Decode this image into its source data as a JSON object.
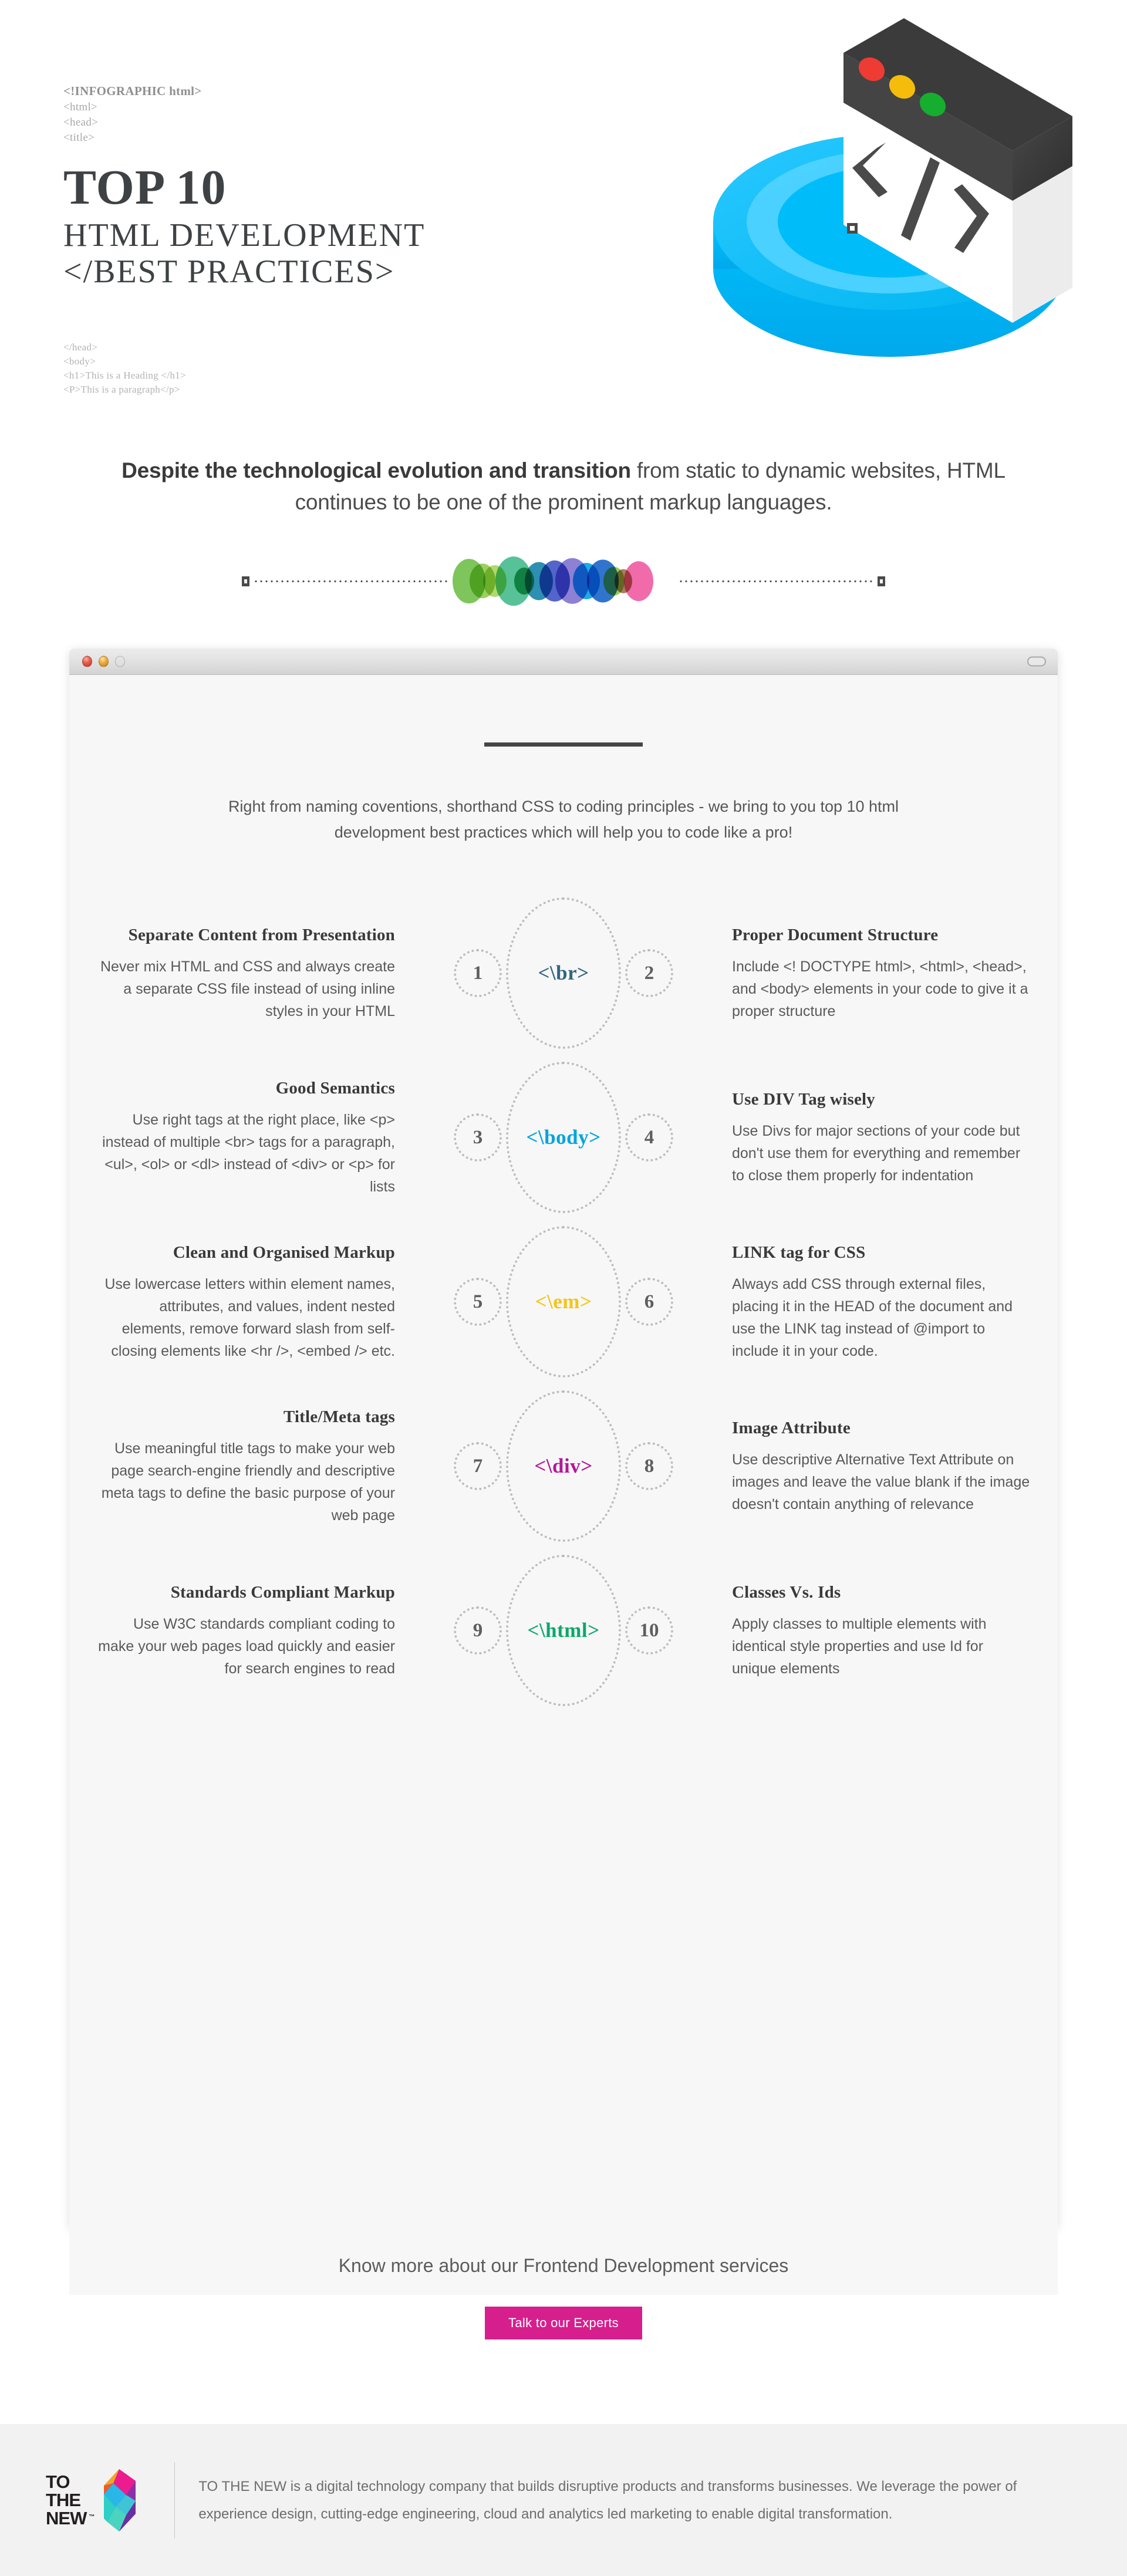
{
  "hero": {
    "code_top_lines": [
      "<!INFOGRAPHIC html>",
      "<html>",
      "<head>",
      "<title>"
    ],
    "title_main": "TOP 10",
    "title_line2": "HTML DEVELOPMENT",
    "title_line3": "</BEST PRACTICES>",
    "code_bottom_lines": [
      "</head>",
      "<body>",
      "<h1>This is a Heading </h1>",
      "<P>This is a paragraph</p>"
    ],
    "illustration": "isometric-code-window-icon"
  },
  "subtitle": {
    "bold_part": "Despite the technological evolution and transition",
    "rest_part": " from static to dynamic websites, HTML continues to be one of the prominent markup languages."
  },
  "divider": {
    "circle_colors": [
      "#6cbe45",
      "#8fc94a",
      "#a6d25a",
      "#3fb98a",
      "#12a05a",
      "#0f7fa8",
      "#3b4fc4",
      "#7c6fd0",
      "#00a0e3",
      "#1461c8",
      "#8cc63f",
      "#9c6b4a",
      "#f0569e"
    ]
  },
  "browser": {
    "traffic_lights": [
      "close-red",
      "minimize-yellow",
      "maximize-green"
    ],
    "resize_control": "window-resize-grip",
    "intro": "Right from naming coventions, shorthand CSS to coding principles - we bring to you top 10 html development best practices which will help you to code like a pro!"
  },
  "rows": [
    {
      "tag": "<\\br>",
      "tag_color": "#31667f",
      "left_number": "1",
      "right_number": "2",
      "left": {
        "heading": "Separate Content from Presentation",
        "body": "Never mix HTML and CSS and always create a separate CSS file instead of using inline styles in your HTML"
      },
      "right": {
        "heading": "Proper Document Structure",
        "body": "Include <! DOCTYPE html>, <html>, <head>, and <body> elements in your code to give it a proper structure"
      }
    },
    {
      "tag": "<\\body>",
      "tag_color": "#00a3e0",
      "left_number": "3",
      "right_number": "4",
      "left": {
        "heading": "Good Semantics",
        "body": "Use right tags at the right place, like <p> instead of multiple <br> tags for a paragraph, <ul>, <ol> or <dl> instead of <div> or <p> for lists"
      },
      "right": {
        "heading": "Use DIV Tag wisely",
        "body": "Use Divs for major sections of your code but don't use them for everything and remember to close them properly for indentation"
      }
    },
    {
      "tag": "<\\em>",
      "tag_color": "#f5c518",
      "left_number": "5",
      "right_number": "6",
      "left": {
        "heading": "Clean and Organised Markup",
        "body": "Use lowercase letters within element names, attributes, and values, indent nested elements, remove forward slash from self-closing elements like <hr />, <embed /> etc."
      },
      "right": {
        "heading": "LINK tag for CSS",
        "body": "Always add CSS through external files, placing it in the HEAD of the document and use the LINK tag instead of @import to include it in your code."
      }
    },
    {
      "tag": "<\\div>",
      "tag_color": "#b4179b",
      "left_number": "7",
      "right_number": "8",
      "left": {
        "heading": "Title/Meta tags",
        "body": "Use meaningful title tags to make your web page search-engine friendly and descriptive meta tags to define the basic purpose of your web page"
      },
      "right": {
        "heading": "Image Attribute",
        "body": "Use descriptive Alternative Text Attribute on images and leave the value blank if the image doesn't contain anything of relevance"
      }
    },
    {
      "tag": "<\\html>",
      "tag_color": "#0aa96a",
      "left_number": "9",
      "right_number": "10",
      "left": {
        "heading": "Standards Compliant Markup",
        "body": "Use W3C standards compliant coding to make your web pages load quickly and easier for search engines to read"
      },
      "right": {
        "heading": "Classes Vs. Ids",
        "body": "Apply classes to multiple elements with identical style properties and use Id for unique elements"
      }
    }
  ],
  "cta": {
    "text": "Know more about our Frontend Development services",
    "button_label": "Talk to our Experts",
    "button_color": "#d61f8d"
  },
  "footer": {
    "logo_line1": "TO",
    "logo_line2": "THE",
    "logo_line3": "NEW",
    "logo_tm": "™",
    "description": "TO THE NEW is a digital technology company that builds disruptive products and transforms businesses. We leverage the power of experience design, cutting-edge engineering, cloud and analytics led marketing to enable digital transformation."
  }
}
